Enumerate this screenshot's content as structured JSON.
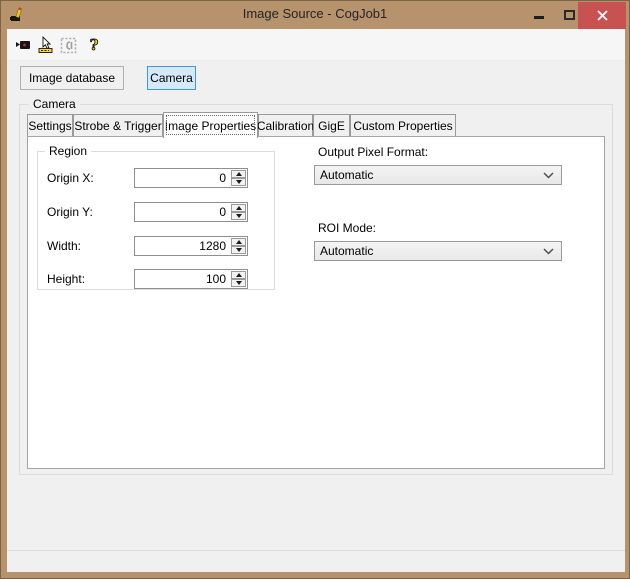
{
  "window": {
    "title": "Image Source - CogJob1"
  },
  "titlebar": {
    "icons": [
      "app-icon",
      "minimize-icon",
      "maximize-icon",
      "close-icon"
    ]
  },
  "toolbar": {
    "icons": [
      {
        "name": "acquire-camera-icon",
        "disabled": false
      },
      {
        "name": "pointer-ruler-icon",
        "disabled": false
      },
      {
        "name": "region-select-icon",
        "disabled": true
      },
      {
        "name": "help-icon",
        "disabled": false
      }
    ]
  },
  "source_buttons": {
    "image_database": "Image database",
    "camera": "Camera"
  },
  "camera_group": {
    "label": "Camera"
  },
  "tabs": [
    {
      "label": "Settings",
      "selected": false
    },
    {
      "label": "Strobe & Trigger",
      "selected": false
    },
    {
      "label": "Image Properties",
      "selected": true
    },
    {
      "label": "Calibration",
      "selected": false
    },
    {
      "label": "GigE",
      "selected": false
    },
    {
      "label": "Custom Properties",
      "selected": false
    }
  ],
  "region": {
    "label": "Region",
    "fields": [
      {
        "label": "Origin X:",
        "value": "0"
      },
      {
        "label": "Origin Y:",
        "value": "0"
      },
      {
        "label": "Width:",
        "value": "1280"
      },
      {
        "label": "Height:",
        "value": "100"
      }
    ]
  },
  "right_panel": {
    "output_pixel_format": {
      "label": "Output Pixel Format:",
      "value": "Automatic"
    },
    "roi_mode": {
      "label": "ROI Mode:",
      "value": "Automatic"
    }
  },
  "colors": {
    "titlebar_tan": "#b6936c",
    "close_red": "#c85252",
    "selected_button_fill": "#d5e9f9",
    "selected_button_border": "#3f98da",
    "client_bg": "#f0f0f0",
    "help_yellow": "#ffd400"
  }
}
